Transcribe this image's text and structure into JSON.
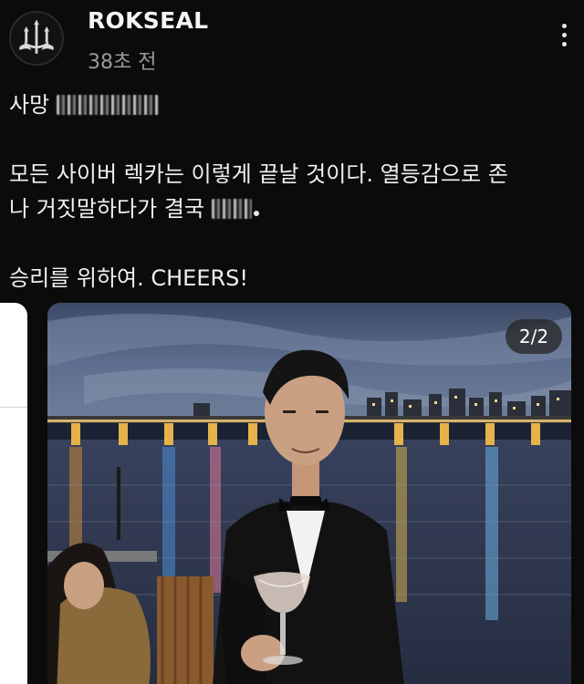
{
  "post": {
    "author": "ROKSEAL",
    "time": "38초 전",
    "line1": "사망",
    "line2a": "모든 사이버 렉카는 이렇게 끝날 것이다. 열등감으로 존",
    "line2b": "나 거짓말하다가 결국",
    "line3": "승리를 위하여. CHEERS!"
  },
  "carousel": {
    "page_indicator": "2/2"
  },
  "icons": {
    "avatar": "trident-seal-logo",
    "more": "more-vertical-icon"
  },
  "colors": {
    "background": "#0b0b0b",
    "text": "#f0f0f0",
    "secondary_text": "#9a9a9a"
  }
}
